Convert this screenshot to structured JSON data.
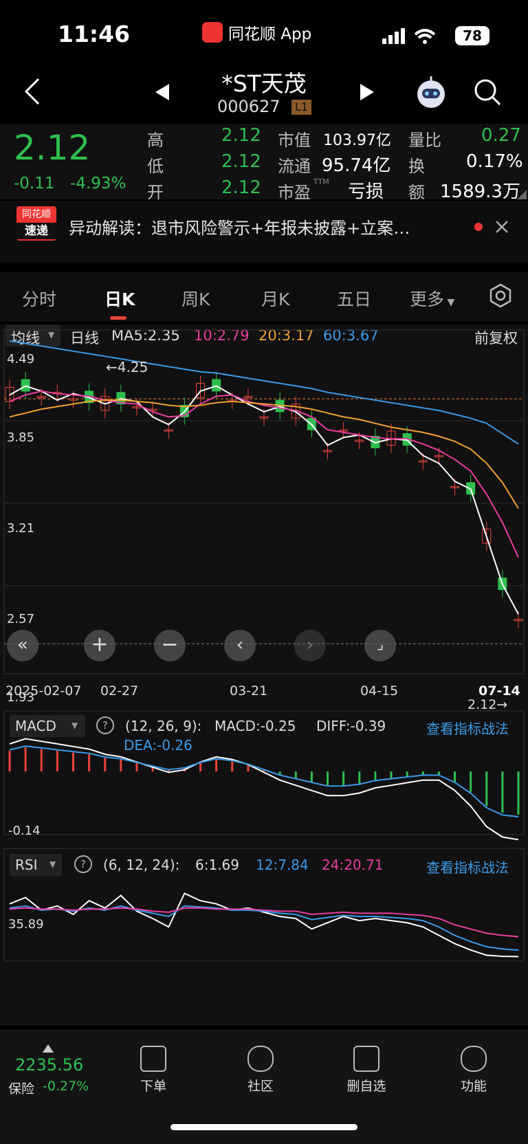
{
  "status": {
    "time": "11:46",
    "app": "同花顺 App",
    "battery": "78"
  },
  "header": {
    "title": "*ST天茂",
    "code": "000627",
    "level": "L1"
  },
  "quote": {
    "price": "2.12",
    "change": "-0.11",
    "change_pct": "-4.93%",
    "high_label": "高",
    "high": "2.12",
    "low_label": "低",
    "low": "2.12",
    "open_label": "开",
    "open": "2.12",
    "mktcap_label": "市值",
    "mktcap": "103.97亿",
    "float_label": "流通",
    "float": "95.74亿",
    "pe_label": "市盈",
    "pe_sup": "TTM",
    "pe": "亏损",
    "vr_label": "量比",
    "vr": "0.27",
    "turnover_label": "换",
    "turnover": "0.17%",
    "amount_label": "额",
    "amount": "1589.3万"
  },
  "news": {
    "badge_top": "同花顺",
    "badge_bottom": "速递",
    "text": "异动解读：退市风险警示+年报未披露+立案…"
  },
  "tabs": [
    {
      "label": "分时"
    },
    {
      "label": "日K"
    },
    {
      "label": "周K"
    },
    {
      "label": "月K"
    },
    {
      "label": "五日"
    },
    {
      "label": "更多"
    }
  ],
  "kline": {
    "selector": "均线",
    "period": "日线",
    "ma5": "MA5:2.35",
    "ma10": "10:2.79",
    "ma20": "20:3.17",
    "ma60": "60:3.67",
    "adjust": "前复权",
    "y_labels": [
      "4.49",
      "3.85",
      "3.21",
      "2.57",
      "1.93"
    ],
    "x_labels": [
      "2025-02-07",
      "02-27",
      "03-21",
      "04-15",
      "07-14"
    ],
    "high_mark": "←4.25",
    "last_mark": "2.12→",
    "colors": {
      "ma5": "#ffffff",
      "ma10": "#e83ea0",
      "ma20": "#f0a030",
      "ma60": "#3a9ae8",
      "up": "#e8453c",
      "down": "#2ebf4f"
    }
  },
  "chart_data": [
    {
      "type": "line",
      "title": "",
      "series": [
        {
          "name": "MA5",
          "values": [
            4.05,
            4.12,
            4.08,
            4.01,
            4.06,
            4.03,
            3.98,
            4.02,
            4.0,
            3.88,
            3.82,
            3.92,
            4.08,
            4.12,
            4.05,
            3.98,
            3.92,
            3.96,
            3.92,
            3.82,
            3.66,
            3.72,
            3.74,
            3.68,
            3.71,
            3.7,
            3.58,
            3.52,
            3.38,
            3.32,
            2.95,
            2.58,
            2.35
          ]
        },
        {
          "name": "10",
          "values": [
            4.0,
            4.05,
            4.08,
            4.06,
            4.05,
            4.04,
            4.01,
            3.99,
            3.98,
            3.92,
            3.88,
            3.89,
            3.98,
            4.04,
            4.05,
            4.0,
            3.97,
            3.95,
            3.93,
            3.88,
            3.78,
            3.76,
            3.74,
            3.72,
            3.71,
            3.71,
            3.67,
            3.62,
            3.55,
            3.46,
            3.28,
            3.06,
            2.79
          ]
        },
        {
          "name": "20",
          "values": [
            3.88,
            3.91,
            3.94,
            3.96,
            3.98,
            4.0,
            4.01,
            4.01,
            4.0,
            3.99,
            3.97,
            3.96,
            3.97,
            3.99,
            4.0,
            3.99,
            3.98,
            3.97,
            3.96,
            3.94,
            3.91,
            3.88,
            3.86,
            3.83,
            3.8,
            3.78,
            3.76,
            3.73,
            3.69,
            3.63,
            3.52,
            3.37,
            3.17
          ]
        },
        {
          "name": "60",
          "values": [
            4.47,
            4.45,
            4.43,
            4.41,
            4.39,
            4.37,
            4.35,
            4.33,
            4.31,
            4.29,
            4.27,
            4.25,
            4.23,
            4.22,
            4.2,
            4.18,
            4.16,
            4.14,
            4.12,
            4.1,
            4.07,
            4.05,
            4.03,
            4.01,
            3.99,
            3.97,
            3.95,
            3.93,
            3.9,
            3.87,
            3.83,
            3.75,
            3.67
          ]
        }
      ],
      "ylim": [
        1.93,
        4.49
      ]
    },
    {
      "type": "bar",
      "title": "MACD",
      "params": "(12, 26, 9):",
      "macd": "MACD:-0.25",
      "diff": "DIFF:-0.39",
      "dea": "DEA:-0.26",
      "axis_label": "-0.14",
      "link": "查看指标战法",
      "values": [
        0.12,
        0.14,
        0.13,
        0.12,
        0.11,
        0.1,
        0.08,
        0.07,
        0.05,
        0.03,
        0.01,
        0.02,
        0.05,
        0.07,
        0.06,
        0.04,
        0.01,
        -0.02,
        -0.04,
        -0.06,
        -0.08,
        -0.08,
        -0.07,
        -0.05,
        -0.04,
        -0.03,
        -0.02,
        -0.02,
        -0.06,
        -0.12,
        -0.2,
        -0.24,
        -0.25
      ],
      "ylim": [
        -0.35,
        0.2
      ]
    },
    {
      "type": "line",
      "title": "RSI",
      "params": "(6, 12, 24):",
      "rsi6": "6:1.69",
      "rsi12": "12:7.84",
      "rsi24": "24:20.71",
      "axis_label": "35.89",
      "link": "查看指标战法",
      "series": [
        {
          "name": "6",
          "values": [
            52,
            58,
            46,
            50,
            42,
            55,
            48,
            60,
            45,
            38,
            30,
            62,
            55,
            52,
            46,
            48,
            44,
            40,
            38,
            28,
            34,
            40,
            36,
            38,
            36,
            34,
            30,
            22,
            14,
            8,
            3,
            2,
            1.69
          ]
        },
        {
          "name": "12",
          "values": [
            48,
            50,
            46,
            47,
            45,
            48,
            46,
            50,
            46,
            43,
            40,
            50,
            49,
            48,
            46,
            46,
            45,
            43,
            42,
            37,
            39,
            41,
            40,
            40,
            39,
            38,
            36,
            30,
            22,
            16,
            11,
            9,
            7.84
          ]
        },
        {
          "name": "24",
          "values": [
            47,
            48,
            47,
            47,
            46,
            47,
            47,
            48,
            47,
            45,
            44,
            48,
            48,
            47,
            47,
            47,
            46,
            45,
            45,
            42,
            43,
            44,
            43,
            43,
            43,
            42,
            41,
            38,
            32,
            28,
            24,
            22,
            20.71
          ]
        }
      ],
      "ylim": [
        0,
        80
      ]
    }
  ],
  "bottom": {
    "index_value": "2235.56",
    "index_name": "保险",
    "index_change": "-0.27%",
    "items": [
      {
        "label": "下单"
      },
      {
        "label": "社区"
      },
      {
        "label": "删自选"
      },
      {
        "label": "功能"
      }
    ]
  }
}
